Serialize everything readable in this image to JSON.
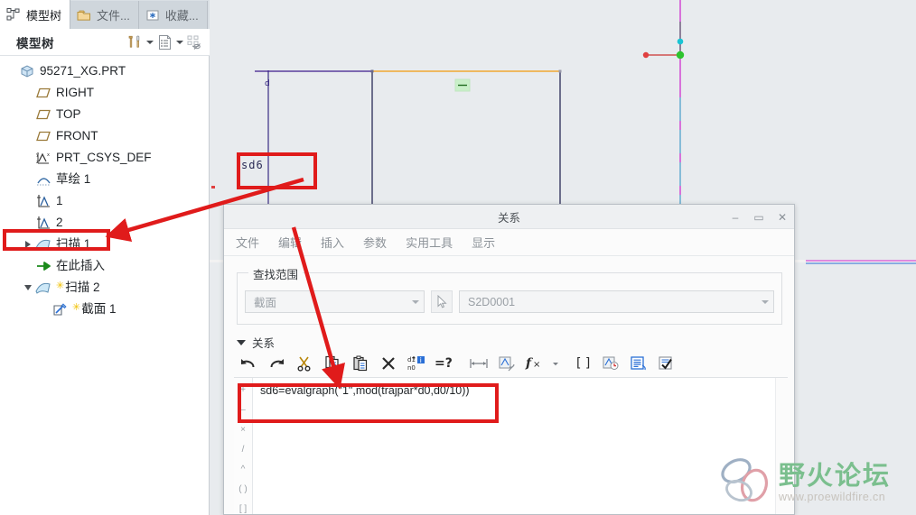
{
  "left_panel": {
    "tabs": [
      {
        "label": "模型树",
        "icon": "model-tree-icon",
        "active": true
      },
      {
        "label": "文件...",
        "icon": "folder-icon",
        "active": false
      },
      {
        "label": "收藏...",
        "icon": "favorites-icon",
        "active": false
      }
    ],
    "toolbar": {
      "title": "模型树",
      "buttons": [
        {
          "name": "tools-settings-icon"
        },
        {
          "name": "chevron-down-icon"
        },
        {
          "name": "tree-columns-icon"
        },
        {
          "name": "chevron-down-icon"
        },
        {
          "name": "tree-filter-icon"
        }
      ]
    },
    "tree": [
      {
        "label": "95271_XG.PRT",
        "icon": "part-icon",
        "indent": 0,
        "arrow": "none",
        "star": false
      },
      {
        "label": "RIGHT",
        "icon": "datum-plane-icon",
        "indent": 1,
        "arrow": "none",
        "star": false
      },
      {
        "label": "TOP",
        "icon": "datum-plane-icon",
        "indent": 1,
        "arrow": "none",
        "star": false
      },
      {
        "label": "FRONT",
        "icon": "datum-plane-icon",
        "indent": 1,
        "arrow": "none",
        "star": false
      },
      {
        "label": "PRT_CSYS_DEF",
        "icon": "csys-icon",
        "indent": 1,
        "arrow": "none",
        "star": false
      },
      {
        "label": "草绘 1",
        "icon": "sketch-icon",
        "indent": 1,
        "arrow": "none",
        "star": false
      },
      {
        "label": "1",
        "icon": "graph-icon",
        "indent": 1,
        "arrow": "none",
        "star": false
      },
      {
        "label": "2",
        "icon": "graph-icon",
        "indent": 1,
        "arrow": "none",
        "star": false
      },
      {
        "label": "扫描 1",
        "icon": "sweep-icon",
        "indent": 1,
        "arrow": "right",
        "star": false
      },
      {
        "label": "在此插入",
        "icon": "insert-here-icon",
        "indent": 1,
        "arrow": "none",
        "star": false
      },
      {
        "label": "扫描 2",
        "icon": "sweep-icon",
        "indent": 1,
        "arrow": "down",
        "star": true
      },
      {
        "label": "截面 1",
        "icon": "section-icon",
        "indent": 2,
        "arrow": "none",
        "star": true
      }
    ]
  },
  "viewport": {
    "dimension_label": "sd6"
  },
  "dialog": {
    "title": "关系",
    "window_buttons": {
      "minimize": "–",
      "maximize": "▭",
      "close": "✕"
    },
    "menu": [
      "文件",
      "编辑",
      "插入",
      "参数",
      "实用工具",
      "显示"
    ],
    "scope": {
      "legend": "查找范围",
      "type_value": "截面",
      "select_value": "S2D0001",
      "pick_icon": "pointer-select-icon"
    },
    "relations": {
      "header": "关系",
      "toolbar": [
        {
          "name": "undo-icon",
          "glyph": "undo"
        },
        {
          "name": "redo-icon",
          "glyph": "redo"
        },
        {
          "name": "cut-icon",
          "glyph": "cut"
        },
        {
          "name": "copy-icon",
          "glyph": "copy"
        },
        {
          "name": "paste-icon",
          "glyph": "paste"
        },
        {
          "name": "delete-icon",
          "glyph": "delete"
        },
        {
          "name": "sort-relations-icon",
          "glyph": "sort"
        },
        {
          "name": "evaluate-icon",
          "glyph": "equalq"
        },
        {
          "name": "dimension-toggle-icon",
          "glyph": "dim"
        },
        {
          "name": "show-dimensions-icon",
          "glyph": "showdim"
        },
        {
          "name": "insert-function-icon",
          "glyph": "fx"
        },
        {
          "name": "chevron-down-icon",
          "glyph": "caret"
        },
        {
          "name": "unit-brackets-icon",
          "glyph": "brackets"
        },
        {
          "name": "history-icon",
          "glyph": "history"
        },
        {
          "name": "parameters-icon",
          "glyph": "params"
        },
        {
          "name": "verify-icon",
          "glyph": "verify"
        }
      ],
      "operators": [
        "+",
        "–",
        "×",
        "/",
        "^",
        "( )",
        "[ ]"
      ],
      "editor_lines": [
        "sd6=evalgraph(\"1\",mod(trajpar*d0,d0/10))"
      ]
    }
  },
  "watermark": {
    "main": "野火论坛",
    "sub": "www.proewildfire.cn"
  },
  "colors": {
    "annotation_red": "#e01b1b",
    "accent_orange": "#f0a830",
    "geometry_purple": "#3b1a8c",
    "axis_magenta": "#cc22cc",
    "watermark_green": "#7bbf8e"
  }
}
